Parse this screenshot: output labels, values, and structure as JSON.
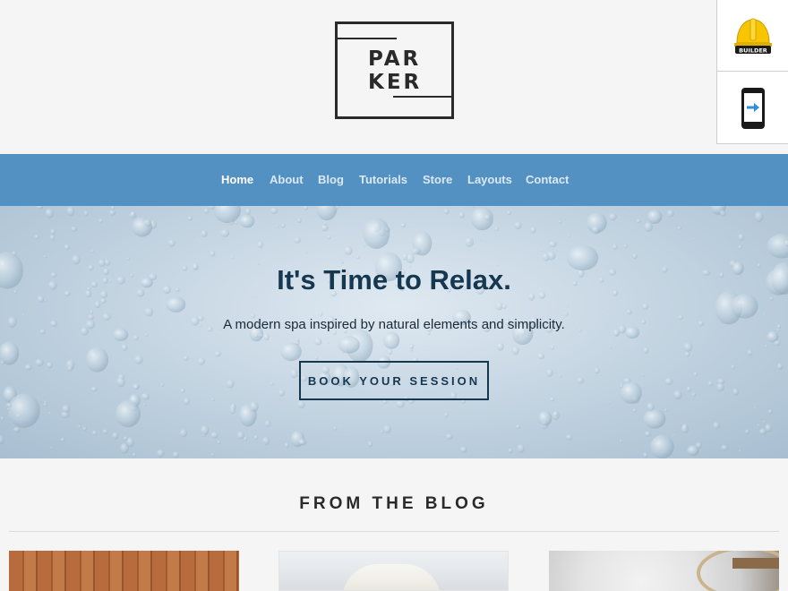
{
  "logo": {
    "line1": "PAR",
    "line2": "KER"
  },
  "side_panel": {
    "builder_badge": "BUILDER"
  },
  "nav": {
    "items": [
      "Home",
      "About",
      "Blog",
      "Tutorials",
      "Store",
      "Layouts",
      "Contact"
    ],
    "active": "Home"
  },
  "hero": {
    "title": "It's Time to Relax.",
    "subtitle": "A modern spa inspired by natural elements and simplicity.",
    "cta": "BOOK YOUR SESSION"
  },
  "blog": {
    "heading": "FROM THE BLOG"
  },
  "colors": {
    "nav_bg": "#5491c3",
    "hero_text": "#163750",
    "page_bg": "#f5f5f5"
  },
  "icons": {
    "builder": "hard-hat-icon",
    "mobile_preview": "mobile-arrow-icon"
  }
}
